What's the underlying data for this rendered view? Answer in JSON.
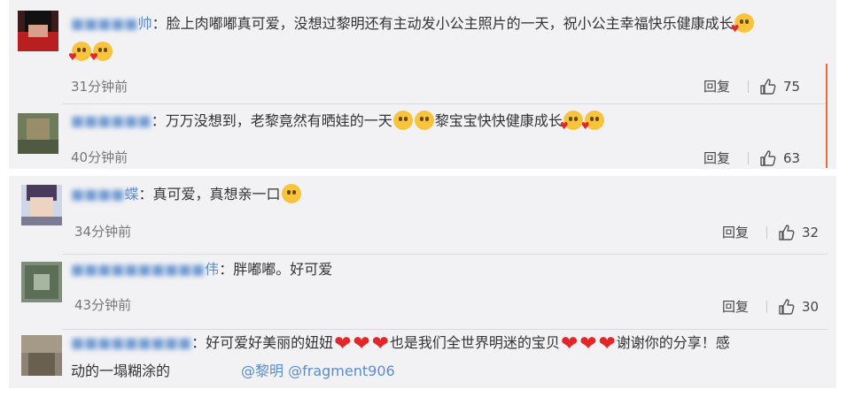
{
  "comments": [
    {
      "username_tail": "帅",
      "text": "：脸上肉嘟嘟真可爱，没想过黎明还有主动发小公主照片的一天，祝小公主幸福快乐健康成长",
      "time": "31分钟前",
      "reply_label": "回复",
      "likes": "75"
    },
    {
      "username_tail": "",
      "text_a": "：万万没想到，老黎竟然有晒娃的一天",
      "text_b": "黎宝宝快快健康成长",
      "time": "40分钟前",
      "reply_label": "回复",
      "likes": "63"
    },
    {
      "username_tail": "蝶",
      "text": "：真可爱，真想亲一口",
      "time": "34分钟前",
      "reply_label": "回复",
      "likes": "32"
    },
    {
      "username_tail": "伟",
      "text": "：胖嘟嘟。好可爱",
      "time": "43分钟前",
      "reply_label": "回复",
      "likes": "30"
    },
    {
      "username_tail": "",
      "text_a": "：好可爱好美丽的妞妞",
      "text_b": "也是我们全世界明迷的宝贝",
      "text_c": "谢谢你的分享！感",
      "line2": "动的一塌糊涂的",
      "mention1": "@黎明",
      "mention2": "@fragment906"
    }
  ],
  "icons": {
    "like": "thumbs-up-icon",
    "emoji_heart": "kiss-heart-emoji",
    "emoji_scream": "scream-emoji",
    "emoji_kiss": "kissing-emoji",
    "heart": "red-heart-emoji"
  },
  "colors": {
    "card_bg": "#f2f2f5",
    "link": "#5b8ccc",
    "heart": "#e2262a",
    "emoji": "#f7c43c",
    "scroll_accent": "#f26b3a"
  }
}
